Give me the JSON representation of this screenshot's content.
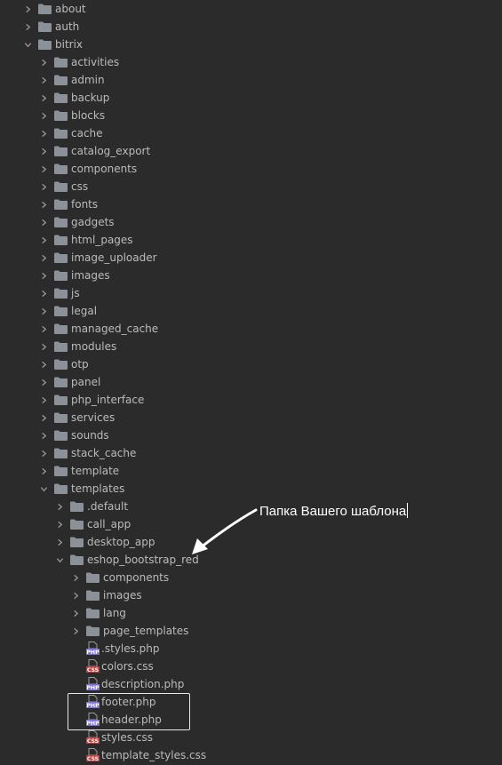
{
  "tree": [
    {
      "label": "about",
      "type": "folder",
      "depth": 0,
      "expanded": false
    },
    {
      "label": "auth",
      "type": "folder",
      "depth": 0,
      "expanded": false
    },
    {
      "label": "bitrix",
      "type": "folder",
      "depth": 0,
      "expanded": true
    },
    {
      "label": "activities",
      "type": "folder",
      "depth": 1,
      "expanded": false
    },
    {
      "label": "admin",
      "type": "folder",
      "depth": 1,
      "expanded": false
    },
    {
      "label": "backup",
      "type": "folder",
      "depth": 1,
      "expanded": false
    },
    {
      "label": "blocks",
      "type": "folder",
      "depth": 1,
      "expanded": false
    },
    {
      "label": "cache",
      "type": "folder",
      "depth": 1,
      "expanded": false
    },
    {
      "label": "catalog_export",
      "type": "folder",
      "depth": 1,
      "expanded": false
    },
    {
      "label": "components",
      "type": "folder",
      "depth": 1,
      "expanded": false
    },
    {
      "label": "css",
      "type": "folder",
      "depth": 1,
      "expanded": false
    },
    {
      "label": "fonts",
      "type": "folder",
      "depth": 1,
      "expanded": false
    },
    {
      "label": "gadgets",
      "type": "folder",
      "depth": 1,
      "expanded": false
    },
    {
      "label": "html_pages",
      "type": "folder",
      "depth": 1,
      "expanded": false
    },
    {
      "label": "image_uploader",
      "type": "folder",
      "depth": 1,
      "expanded": false
    },
    {
      "label": "images",
      "type": "folder",
      "depth": 1,
      "expanded": false
    },
    {
      "label": "js",
      "type": "folder",
      "depth": 1,
      "expanded": false
    },
    {
      "label": "legal",
      "type": "folder",
      "depth": 1,
      "expanded": false
    },
    {
      "label": "managed_cache",
      "type": "folder",
      "depth": 1,
      "expanded": false
    },
    {
      "label": "modules",
      "type": "folder",
      "depth": 1,
      "expanded": false
    },
    {
      "label": "otp",
      "type": "folder",
      "depth": 1,
      "expanded": false
    },
    {
      "label": "panel",
      "type": "folder",
      "depth": 1,
      "expanded": false
    },
    {
      "label": "php_interface",
      "type": "folder",
      "depth": 1,
      "expanded": false
    },
    {
      "label": "services",
      "type": "folder",
      "depth": 1,
      "expanded": false
    },
    {
      "label": "sounds",
      "type": "folder",
      "depth": 1,
      "expanded": false
    },
    {
      "label": "stack_cache",
      "type": "folder",
      "depth": 1,
      "expanded": false
    },
    {
      "label": "template",
      "type": "folder",
      "depth": 1,
      "expanded": false
    },
    {
      "label": "templates",
      "type": "folder",
      "depth": 1,
      "expanded": true
    },
    {
      "label": ".default",
      "type": "folder",
      "depth": 2,
      "expanded": false
    },
    {
      "label": "call_app",
      "type": "folder",
      "depth": 2,
      "expanded": false
    },
    {
      "label": "desktop_app",
      "type": "folder",
      "depth": 2,
      "expanded": false
    },
    {
      "label": "eshop_bootstrap_red",
      "type": "folder",
      "depth": 2,
      "expanded": true
    },
    {
      "label": "components",
      "type": "folder",
      "depth": 3,
      "expanded": false
    },
    {
      "label": "images",
      "type": "folder",
      "depth": 3,
      "expanded": false
    },
    {
      "label": "lang",
      "type": "folder",
      "depth": 3,
      "expanded": false
    },
    {
      "label": "page_templates",
      "type": "folder",
      "depth": 3,
      "expanded": false
    },
    {
      "label": ".styles.php",
      "type": "php",
      "depth": 3
    },
    {
      "label": "colors.css",
      "type": "css",
      "depth": 3
    },
    {
      "label": "description.php",
      "type": "php",
      "depth": 3
    },
    {
      "label": "footer.php",
      "type": "php",
      "depth": 3
    },
    {
      "label": "header.php",
      "type": "php",
      "depth": 3
    },
    {
      "label": "styles.css",
      "type": "css",
      "depth": 3
    },
    {
      "label": "template_styles.css",
      "type": "css",
      "depth": 3
    }
  ],
  "icons": {
    "folder": "folder-icon",
    "php": "php-file-icon",
    "css": "css-file-icon"
  },
  "colors": {
    "background": "#2b2b2b",
    "folder": "#8a9199",
    "text": "#bbbbbb",
    "php": "#7a6ee0",
    "css": "#c43c3c",
    "annotation": "#ffffff"
  },
  "file_badges": {
    "php": "PHP",
    "css": "CSS"
  },
  "annotation": {
    "text": "Папка Вашего шаблона"
  }
}
